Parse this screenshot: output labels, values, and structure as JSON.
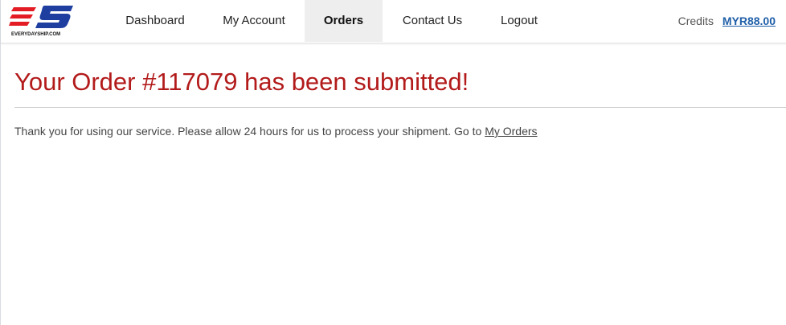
{
  "header": {
    "logo_text": "EVERYDAYSHIP.COM",
    "nav": [
      {
        "label": "Dashboard"
      },
      {
        "label": "My Account"
      },
      {
        "label": "Orders"
      },
      {
        "label": "Contact Us"
      },
      {
        "label": "Logout"
      }
    ],
    "active_nav": "Orders",
    "credits_label": "Credits",
    "credits_value": "MYR88.00"
  },
  "main": {
    "title": "Your Order #117079 has been submitted!",
    "message": "Thank you for using our service. Please allow 24 hours for us to process your shipment. Go to",
    "link_label": "My Orders"
  },
  "colors": {
    "title": "#b31b1b",
    "credits_link": "#1f5ea8",
    "active_nav_bg": "#eeeeee",
    "logo_red": "#e31b23",
    "logo_blue": "#1e3fa0"
  }
}
